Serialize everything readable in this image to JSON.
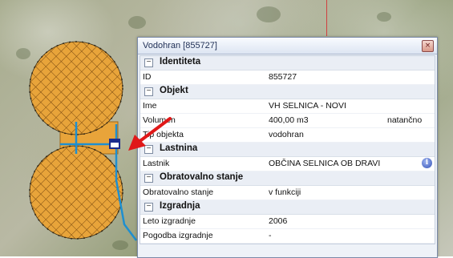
{
  "window": {
    "title": "Vodohran [855727]",
    "close_glyph": "×"
  },
  "sections": [
    {
      "name": "Identiteta",
      "rows": [
        {
          "key": "ID",
          "value": "855727"
        }
      ]
    },
    {
      "name": "Objekt",
      "rows": [
        {
          "key": "Ime",
          "value": "VH SELNICA - NOVI"
        },
        {
          "key": "Volumen",
          "value": "400,00 m3",
          "extra": "natančno"
        },
        {
          "key": "Tip objekta",
          "value": "vodohran"
        }
      ]
    },
    {
      "name": "Lastnina",
      "rows": [
        {
          "key": "Lastnik",
          "value": "OBČINA SELNICA OB DRAVI",
          "icon": "info-icon"
        }
      ]
    },
    {
      "name": "Obratovalno stanje",
      "rows": [
        {
          "key": "Obratovalno stanje",
          "value": "v funkciji"
        }
      ]
    },
    {
      "name": "Izgradnja",
      "rows": [
        {
          "key": "Leto izgradnje",
          "value": "2006"
        },
        {
          "key": "Pogodba izgradnje",
          "value": "-"
        }
      ]
    }
  ],
  "toggle_glyph": "−",
  "colors": {
    "reservoir_fill": "#e8a43a",
    "pipe": "#1e8fd0",
    "arrow": "#e01818",
    "selection": "#1a2b8c"
  }
}
